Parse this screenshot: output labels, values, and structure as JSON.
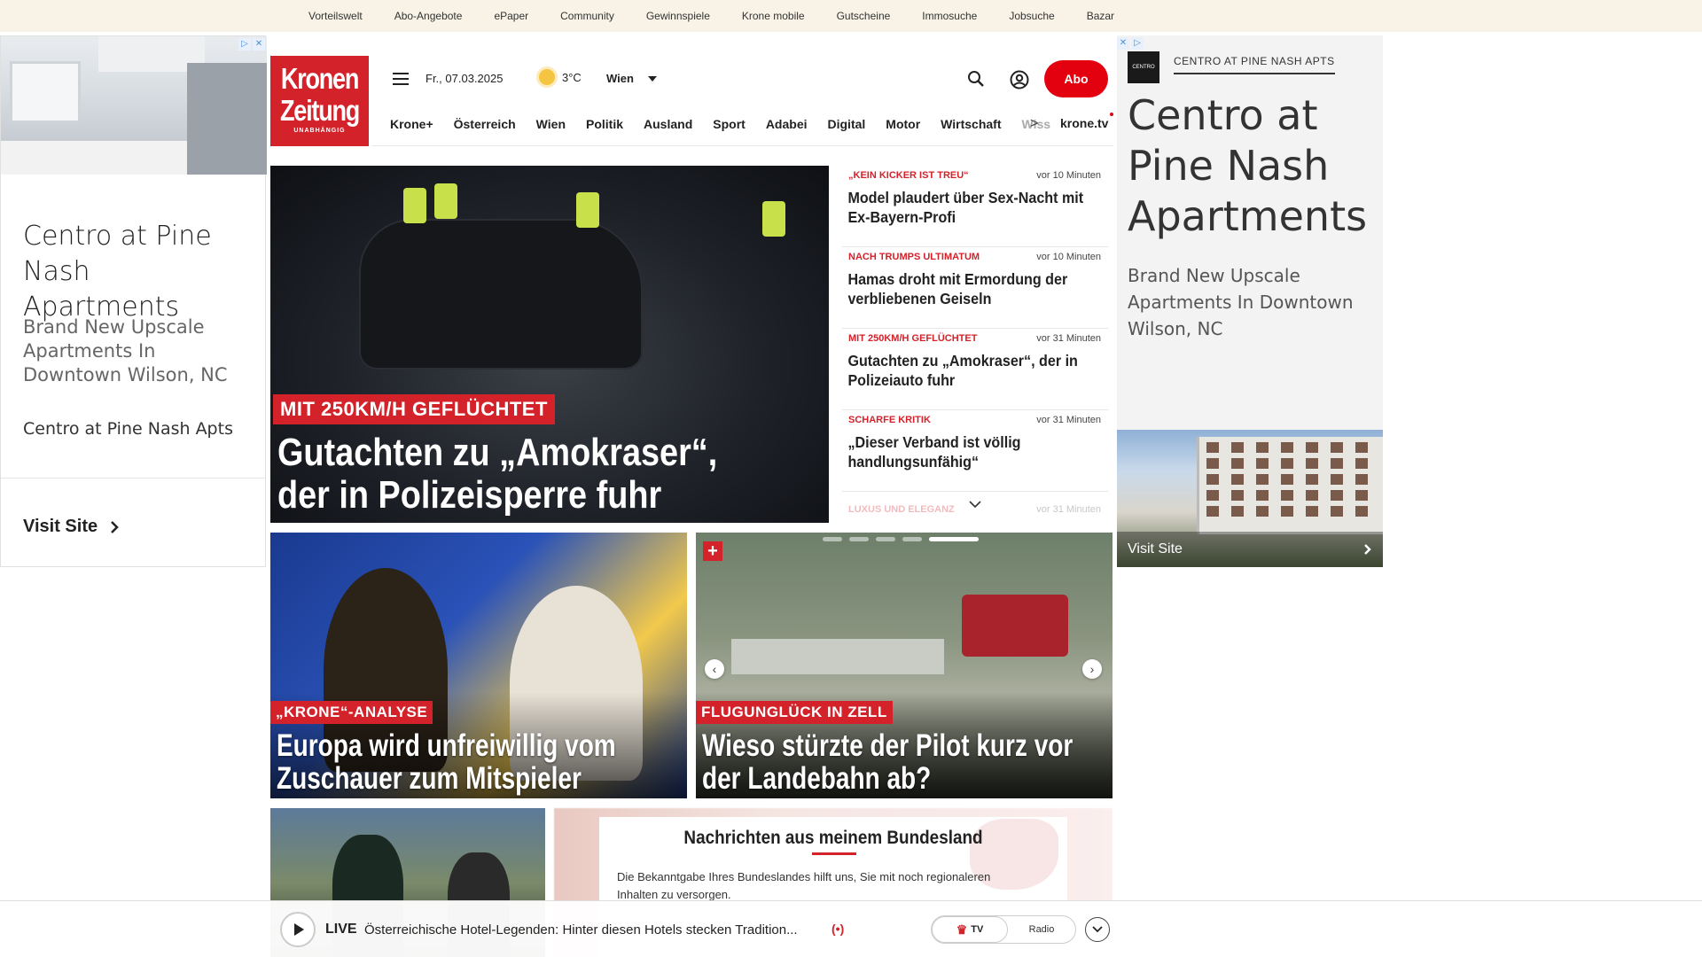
{
  "topnav": [
    "Vorteilswelt",
    "Abo-Angebote",
    "ePaper",
    "Community",
    "Gewinnspiele",
    "Krone mobile",
    "Gutscheine",
    "Immosuche",
    "Jobsuche",
    "Bazar"
  ],
  "ad_left": {
    "title": "Centro at Pine Nash Apartments",
    "description": "Brand New Upscale Apartments In Downtown Wilson, NC",
    "brand": "Centro at Pine Nash Apts",
    "cta": "Visit Site"
  },
  "ad_right": {
    "brand": "CENTRO AT PINE NASH APTS",
    "logo_text": "CENTRO",
    "title": "Centro at Pine Nash Apartments",
    "description": "Brand New Upscale Apartments In Downtown Wilson, NC",
    "cta": "Visit Site"
  },
  "header": {
    "logo_line1": "Kronen",
    "logo_line2": "Zeitung",
    "logo_line3": "UNABHÄNGIG",
    "date": "Fr., 07.03.2025",
    "temperature": "3°C",
    "city": "Wien",
    "abo_label": "Abo",
    "krone_tv": "krone.tv"
  },
  "sections": [
    "Krone+",
    "Österreich",
    "Wien",
    "Politik",
    "Ausland",
    "Sport",
    "Adabei",
    "Digital",
    "Motor",
    "Wirtschaft"
  ],
  "sections_faded": "Wiss",
  "hero": {
    "tag": "MIT 250KM/H GEFLÜCHTET",
    "headline": "Gutachten zu „Amokraser“, der in Polizeisperre fuhr"
  },
  "news": [
    {
      "kicker": "„KEIN KICKER IST TREU“",
      "time": "vor 10 Minuten",
      "title": "Model plaudert über Sex-Nacht mit Ex-Bayern-Profi"
    },
    {
      "kicker": "NACH TRUMPS ULTIMATUM",
      "time": "vor 10 Minuten",
      "title": "Hamas droht mit Ermordung der verbliebenen Geiseln"
    },
    {
      "kicker": "MIT 250KM/H GEFLÜCHTET",
      "time": "vor 31 Minuten",
      "title": "Gutachten zu „Amokraser“, der in Polizeiauto fuhr"
    },
    {
      "kicker": "SCHARFE KRITIK",
      "time": "vor 31 Minuten",
      "title": "„Dieser Verband ist völlig handlungsunfähig“"
    }
  ],
  "news_faded": {
    "kicker": "LUXUS UND ELEGANZ",
    "time": "vor 31 Minuten"
  },
  "cards": [
    {
      "tag": "„KRONE“-ANALYSE",
      "headline": "Europa wird unfreiwillig vom Zuschauer zum Mitspieler"
    },
    {
      "tag": "FLUGUNGLÜCK IN ZELL",
      "headline": "Wieso stürzte der Pilot kurz vor der Landebahn ab?"
    }
  ],
  "carousel": {
    "total": 5,
    "active_index": 4
  },
  "bundesland": {
    "title": "Nachrichten aus meinem Bundesland",
    "text": "Die Bekanntgabe Ihres Bundeslandes hilft uns, Sie mit noch regionaleren Inhalten zu versorgen."
  },
  "livebar": {
    "live_label": "LIVE",
    "text": "Österreichische Hotel-Legenden: Hinter diesen Hotels stecken Tradition...",
    "live_icon": "(•)",
    "tv_label": "TV",
    "radio_label": "Radio"
  }
}
